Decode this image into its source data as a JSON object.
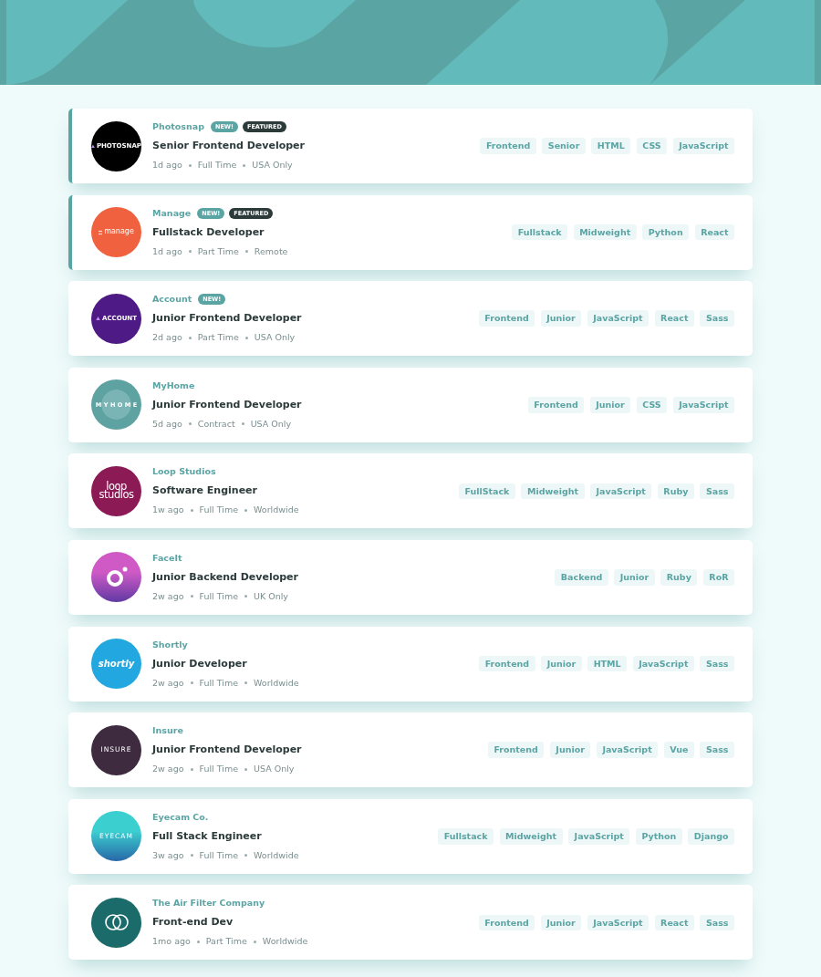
{
  "jobs": [
    {
      "company": "Photosnap",
      "badges": [
        {
          "kind": "new",
          "label": "NEW!"
        },
        {
          "kind": "featured",
          "label": "FEATURED"
        }
      ],
      "featured": true,
      "title": "Senior Frontend Developer",
      "posted": "1d ago",
      "contract": "Full Time",
      "location": "USA Only",
      "tags": [
        "Frontend",
        "Senior",
        "HTML",
        "CSS",
        "JavaScript"
      ],
      "logo": {
        "kind": "triangle",
        "text": "PHOTOSNAP",
        "color": "#000000"
      }
    },
    {
      "company": "Manage",
      "badges": [
        {
          "kind": "new",
          "label": "NEW!"
        },
        {
          "kind": "featured",
          "label": "FEATURED"
        }
      ],
      "featured": true,
      "title": "Fullstack Developer",
      "posted": "1d ago",
      "contract": "Part Time",
      "location": "Remote",
      "tags": [
        "Fullstack",
        "Midweight",
        "Python",
        "React"
      ],
      "logo": {
        "kind": "dots",
        "text": "manage",
        "color": "#f0623f"
      }
    },
    {
      "company": "Account",
      "badges": [
        {
          "kind": "new",
          "label": "NEW!"
        }
      ],
      "featured": false,
      "title": "Junior Frontend Developer",
      "posted": "2d ago",
      "contract": "Part Time",
      "location": "USA Only",
      "tags": [
        "Frontend",
        "Junior",
        "JavaScript",
        "React",
        "Sass"
      ],
      "logo": {
        "kind": "triangle",
        "text": "ACCOUNT",
        "color": "#4e1a85"
      }
    },
    {
      "company": "MyHome",
      "featured": false,
      "title": "Junior Frontend Developer",
      "posted": "5d ago",
      "contract": "Contract",
      "location": "USA Only",
      "tags": [
        "Frontend",
        "Junior",
        "CSS",
        "JavaScript"
      ],
      "logo": {
        "kind": "spaced",
        "text": "MYHOME",
        "color": "#5fa2a2"
      }
    },
    {
      "company": "Loop Studios",
      "featured": false,
      "title": "Software Engineer",
      "posted": "1w ago",
      "contract": "Full Time",
      "location": "Worldwide",
      "tags": [
        "FullStack",
        "Midweight",
        "JavaScript",
        "Ruby",
        "Sass"
      ],
      "logo": {
        "kind": "stacked",
        "text": "loop studios",
        "color": "#8c1a55"
      }
    },
    {
      "company": "FaceIt",
      "featured": false,
      "title": "Junior Backend Developer",
      "posted": "2w ago",
      "contract": "Full Time",
      "location": "UK Only",
      "tags": [
        "Backend",
        "Junior",
        "Ruby",
        "RoR"
      ],
      "logo": {
        "kind": "ring",
        "color": "#cf5ac6",
        "gradient": true
      }
    },
    {
      "company": "Shortly",
      "featured": false,
      "title": "Junior Developer",
      "posted": "2w ago",
      "contract": "Full Time",
      "location": "Worldwide",
      "tags": [
        "Frontend",
        "Junior",
        "HTML",
        "JavaScript",
        "Sass"
      ],
      "logo": {
        "kind": "italic",
        "text": "shortly",
        "color": "#22a7e0"
      }
    },
    {
      "company": "Insure",
      "featured": false,
      "title": "Junior Frontend Developer",
      "posted": "2w ago",
      "contract": "Full Time",
      "location": "USA Only",
      "tags": [
        "Frontend",
        "Junior",
        "JavaScript",
        "Vue",
        "Sass"
      ],
      "logo": {
        "kind": "plain",
        "text": "INSURE",
        "color": "#3e2b3f"
      }
    },
    {
      "company": "Eyecam Co.",
      "featured": false,
      "title": "Full Stack Engineer",
      "posted": "3w ago",
      "contract": "Full Time",
      "location": "Worldwide",
      "tags": [
        "Fullstack",
        "Midweight",
        "JavaScript",
        "Python",
        "Django"
      ],
      "logo": {
        "kind": "plain",
        "text": "EYECAM",
        "color": "#3ccfd0",
        "gradient": true
      }
    },
    {
      "company": "The Air Filter Company",
      "featured": false,
      "title": "Front-end Dev",
      "posted": "1mo ago",
      "contract": "Part Time",
      "location": "Worldwide",
      "tags": [
        "Frontend",
        "Junior",
        "JavaScript",
        "React",
        "Sass"
      ],
      "logo": {
        "kind": "rings",
        "color": "#1c6b6b"
      }
    }
  ]
}
